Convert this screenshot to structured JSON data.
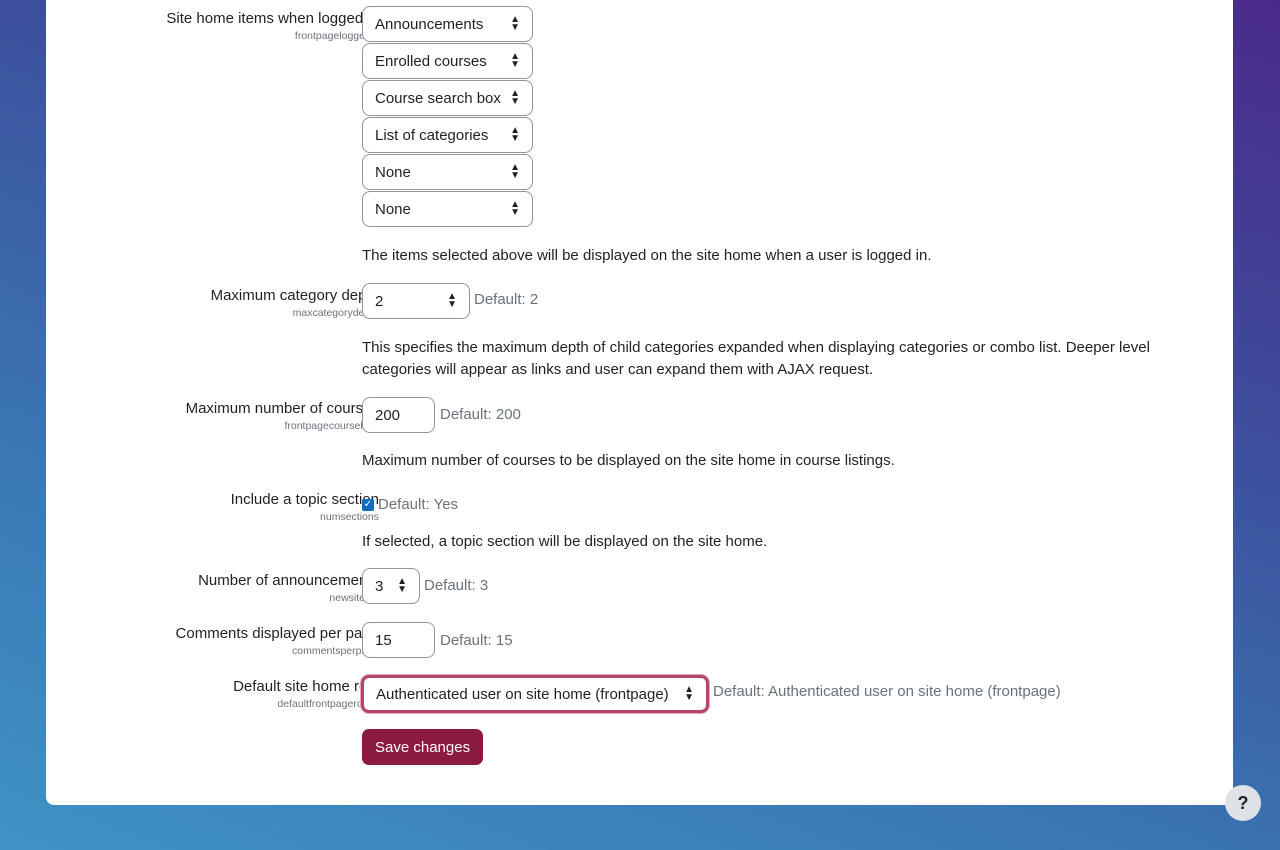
{
  "settings": {
    "frontpageloggedin": {
      "label": "Site home items when logged in",
      "key": "frontpageloggedin",
      "values": [
        "Announcements",
        "Enrolled courses",
        "Course search box",
        "List of categories",
        "None",
        "None"
      ],
      "description": "The items selected above will be displayed on the site home when a user is logged in."
    },
    "maxcategorydepth": {
      "label": "Maximum category depth",
      "key": "maxcategorydepth",
      "value": "2",
      "default": "Default: 2",
      "description": "This specifies the maximum depth of child categories expanded when displaying categories or combo list. Deeper level categories will appear as links and user can expand them with AJAX request."
    },
    "frontpagecourselimit": {
      "label": "Maximum number of courses",
      "key": "frontpagecourselimit",
      "value": "200",
      "default": "Default: 200",
      "description": "Maximum number of courses to be displayed on the site home in course listings."
    },
    "numsections": {
      "label": "Include a topic section",
      "key": "numsections",
      "checked": true,
      "default": "Default: Yes",
      "description": "If selected, a topic section will be displayed on the site home."
    },
    "newsitems": {
      "label": "Number of announcements",
      "key": "newsitems",
      "value": "3",
      "default": "Default: 3"
    },
    "commentsperpage": {
      "label": "Comments displayed per page",
      "key": "commentsperpage",
      "value": "15",
      "default": "Default: 15"
    },
    "defaultfrontpageroleid": {
      "label": "Default site home role",
      "key": "defaultfrontpageroleid",
      "value": "Authenticated user on site home (frontpage)",
      "default": "Default: Authenticated user on site home (frontpage)"
    }
  },
  "save_label": "Save changes",
  "help_label": "?",
  "colors": {
    "accent": "#8b1a3f",
    "focus_ring": "#c0587a",
    "checkbox": "#0f6cbf"
  }
}
